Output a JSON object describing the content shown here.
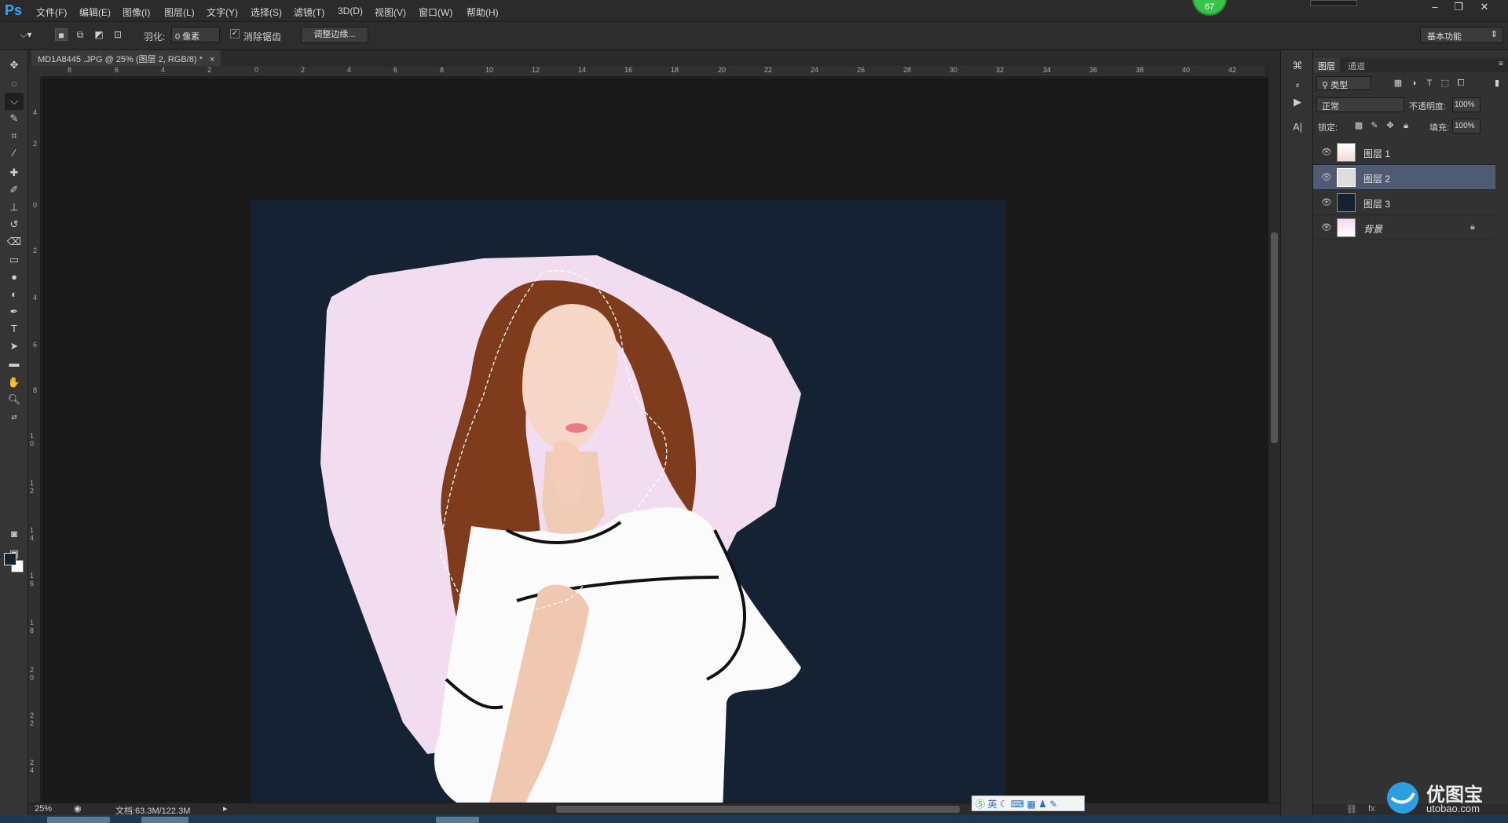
{
  "app": {
    "logo": "Ps"
  },
  "menu": [
    "文件(F)",
    "编辑(E)",
    "图像(I)",
    "图层(L)",
    "文字(Y)",
    "选择(S)",
    "滤镜(T)",
    "3D(D)",
    "视图(V)",
    "窗口(W)",
    "帮助(H)"
  ],
  "status_badge": "67",
  "options": {
    "feather_label": "羽化:",
    "feather_value": "0 像素",
    "antialias_label": "消除锯齿",
    "refine_edge": "调整边缘...",
    "workspace": "基本功能"
  },
  "document": {
    "tab_title": "MD1A8445 .JPG @ 25% (图层 2, RGB/8) *",
    "zoom": "25%",
    "doc_size": "文档:63.3M/122.3M"
  },
  "ruler_h": [
    "8",
    "6",
    "4",
    "2",
    "0",
    "2",
    "4",
    "6",
    "8",
    "10",
    "12",
    "14",
    "16",
    "18",
    "20",
    "22",
    "24",
    "26",
    "28",
    "30",
    "32",
    "34",
    "36",
    "38",
    "40",
    "42"
  ],
  "ruler_v": [
    "4",
    "2",
    "0",
    "2",
    "4",
    "6",
    "8",
    "1 0",
    "1 2",
    "1 4",
    "1 6",
    "1 8",
    "2 0",
    "2 2",
    "2 4"
  ],
  "ime": "英",
  "panel": {
    "tabs": [
      "图层",
      "通道"
    ],
    "filter": "类型",
    "blend": "正常",
    "opacity_label": "不透明度:",
    "opacity": "100%",
    "lock_label": "锁定:",
    "fill_label": "填充:",
    "fill": "100%"
  },
  "layers": [
    {
      "name": "图层 1",
      "selected": false
    },
    {
      "name": "图层 2",
      "selected": true
    },
    {
      "name": "图层 3",
      "selected": false
    },
    {
      "name": "背景",
      "selected": false
    }
  ],
  "watermark": {
    "title": "优图宝",
    "url": "utobao.com"
  },
  "colors": {
    "canvas_bg": "#142233",
    "pink_layer": "#f2dcef",
    "selected_layer": "#4f5a73",
    "ps_blue": "#31a8ff"
  }
}
